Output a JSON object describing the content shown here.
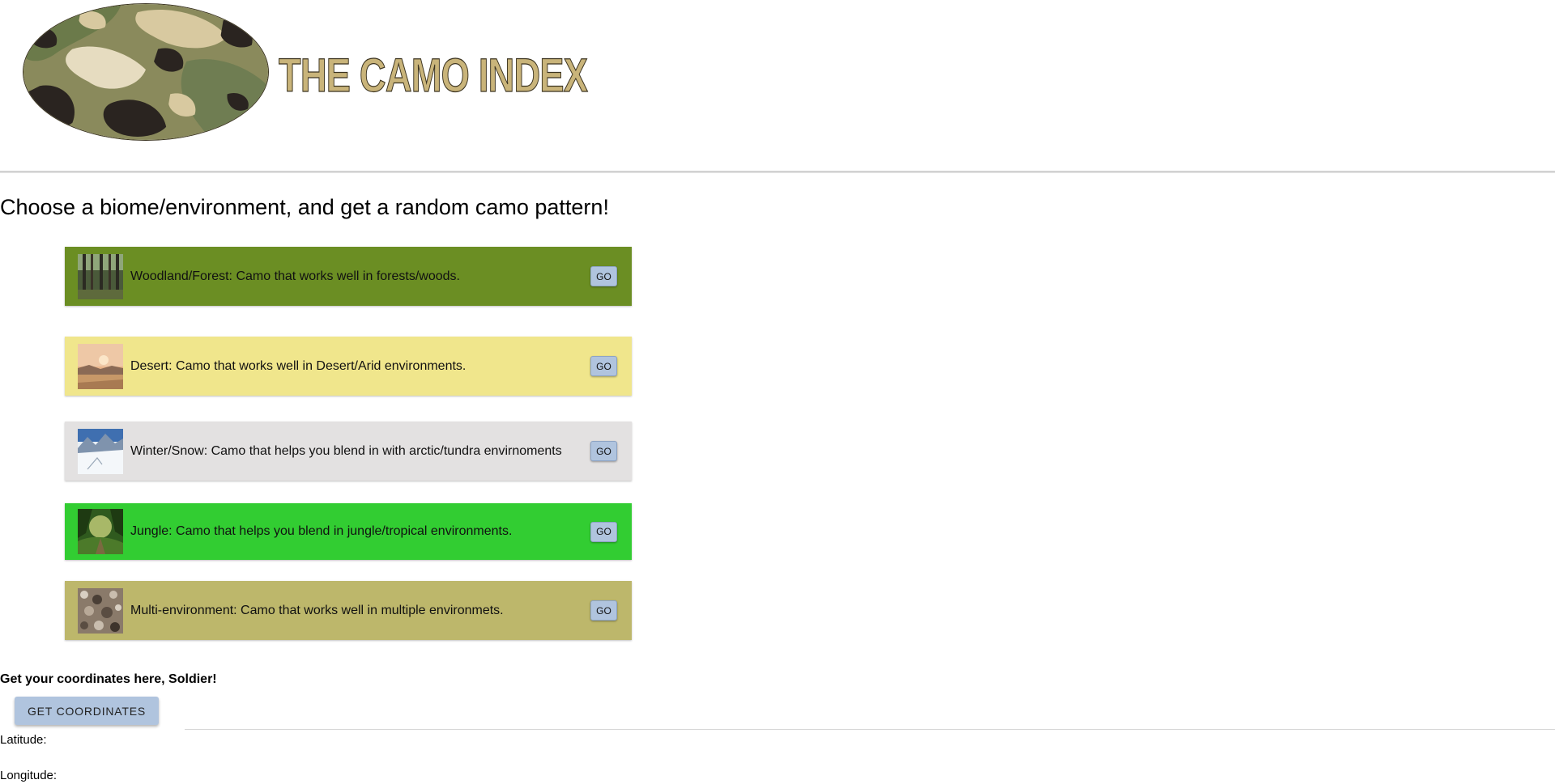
{
  "header": {
    "logo_alt": "camo pattern logo",
    "title": "THE CAMO INDEX"
  },
  "intro": {
    "text": "Choose a biome/environment, and get a random camo pattern!"
  },
  "biomes": [
    {
      "description": "Woodland/Forest: Camo that works well in forests/woods.",
      "go_label": "GO",
      "color": "#6b8e23",
      "icon": "forest-thumbnail"
    },
    {
      "description": "Desert: Camo that works well in Desert/Arid environments.",
      "go_label": "GO",
      "color": "#f0e68c",
      "icon": "desert-thumbnail"
    },
    {
      "description": "Winter/Snow: Camo that helps you blend in with arctic/tundra envirnoments",
      "go_label": "GO",
      "color": "#e3e1e1",
      "icon": "snow-thumbnail"
    },
    {
      "description": "Jungle: Camo that helps you blend in jungle/tropical environments.",
      "go_label": "GO",
      "color": "#32cd32",
      "icon": "jungle-thumbnail"
    },
    {
      "description": "Multi-environment: Camo that works well in multiple environmets.",
      "go_label": "GO",
      "color": "#bdb76b",
      "icon": "multi-thumbnail"
    }
  ],
  "coordinates": {
    "heading": "Get your coordinates here, Soldier!",
    "button_label": "GET COORDINATES",
    "latitude_label": "Latitude:",
    "longitude_label": "Longitude:"
  },
  "colors": {
    "button": "#b0c4de",
    "title_fill": "#c9b47a"
  }
}
